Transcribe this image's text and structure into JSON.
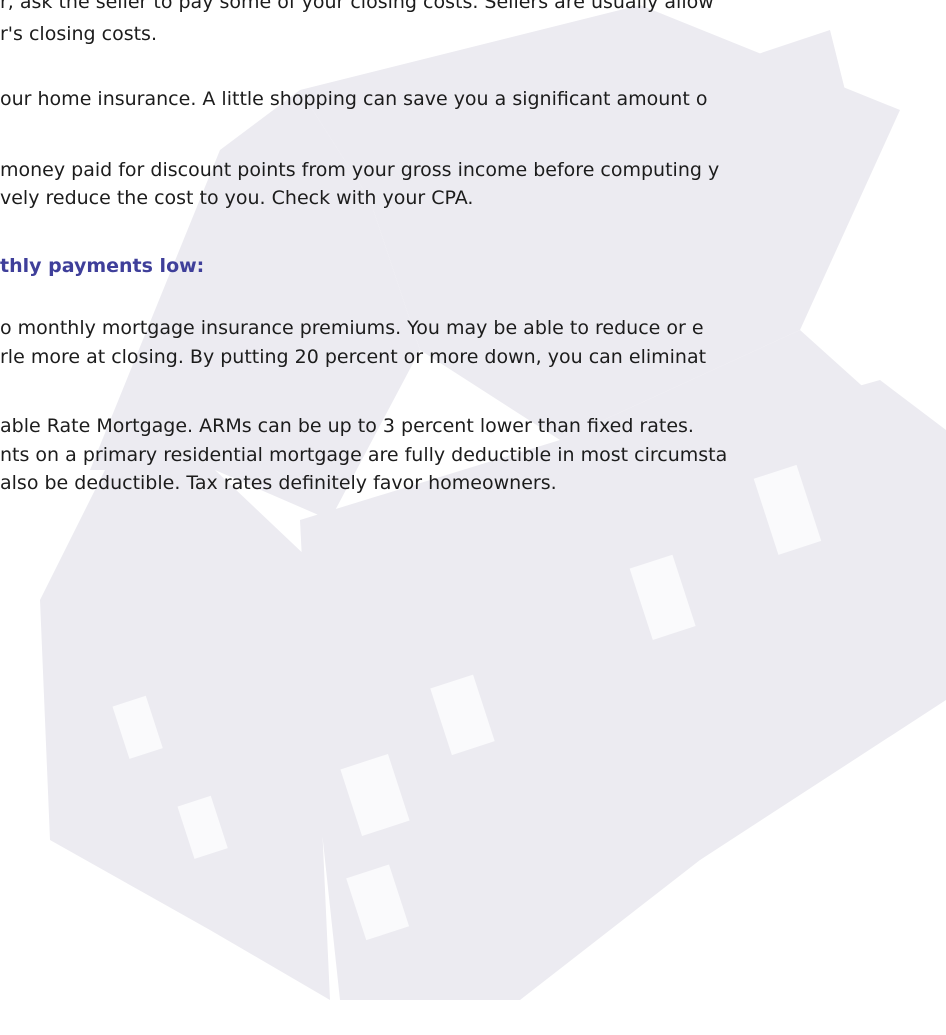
{
  "colors": {
    "text": "#1c1c1c",
    "heading": "#3f3f9a",
    "watermark_house": "#ecebf1",
    "watermark_window": "#fafafc"
  },
  "watermark": {
    "icon": "house-icon"
  },
  "section1": {
    "lines": [
      "r, ask the seller to pay some of your closing costs. Sellers are usually allow",
      "r's closing costs.",
      "our home insurance. A little shopping can save you a significant amount o",
      "money paid for discount points from your gross income before computing y",
      "vely reduce the cost to you. Check with your CPA."
    ]
  },
  "section2": {
    "heading": "thly payments low:",
    "lines": [
      "o monthly mortgage insurance premiums. You may be able to reduce or e",
      "rle more at closing. By putting 20 percent or more down, you can eliminat",
      "able Rate Mortgage. ARMs can be up to 3 percent lower than fixed rates.",
      "nts on a primary residential mortgage are fully deductible in most circumsta",
      "also be deductible. Tax rates definitely favor homeowners."
    ]
  }
}
